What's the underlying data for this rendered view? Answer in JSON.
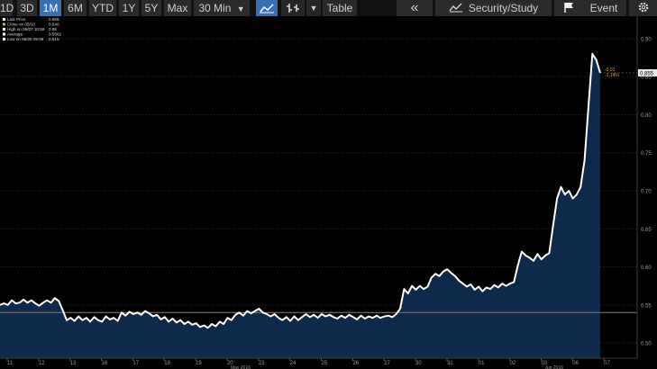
{
  "toolbar": {
    "ranges": [
      "1D",
      "3D",
      "1M",
      "6M",
      "YTD",
      "1Y",
      "5Y",
      "Max"
    ],
    "active_range": "1M",
    "interval": "30 Min",
    "interval_arrow": "▼",
    "chart_style_icon": "line-chart-icon",
    "bar_style_icon": "ohlc-bar-icon",
    "dropdown_arrow": "▼",
    "table_label": "Table",
    "collapse_icon": "double-chevron-left-icon",
    "collapse_glyph": "«",
    "security_label": "Security/Study",
    "security_icon": "study-icon",
    "event_label": "Event",
    "event_icon": "flag-icon",
    "settings_icon": "gear-icon"
  },
  "legend": {
    "lines": [
      {
        "label": "Last Price",
        "value": "0.855",
        "color": "#ffffff"
      },
      {
        "label": "Close on 05/10",
        "value": "0.540",
        "color": "#f0a030"
      },
      {
        "label": "High on 06/07 10:59",
        "value": "0.88",
        "color": "#ffffff"
      },
      {
        "label": "Average",
        "value": "0.5662",
        "color": "#ffffff"
      },
      {
        "label": "Low on 06/26 09:59",
        "value": "0.515",
        "color": "#ffffff"
      }
    ]
  },
  "colors": {
    "line": "#ffffff",
    "fill": "#0d2a4d",
    "ref_line": "#b07a2a",
    "grid": "#2a2a2a",
    "axis_text": "#9a9a9a"
  },
  "chart_data": {
    "type": "area",
    "yticks": [
      0.9,
      0.85,
      0.8,
      0.75,
      0.7,
      0.65,
      0.6,
      0.55,
      0.5
    ],
    "ylim": [
      0.48,
      0.92
    ],
    "ref_value": 0.54,
    "last_label": "0.855",
    "change_label": "-0.01",
    "change_pct": "-1.14%",
    "x_ticks": [
      "11",
      "12",
      "13",
      "16",
      "17",
      "18",
      "19",
      "20",
      "23",
      "24",
      "25",
      "26",
      "27",
      "30",
      "31",
      "01",
      "02",
      "03",
      "06",
      "07"
    ],
    "month_labels": [
      {
        "text": "May 2016",
        "after_tick": "20"
      },
      {
        "text": "Jun 2016",
        "after_tick": "03"
      }
    ],
    "values": [
      0.55,
      0.552,
      0.55,
      0.556,
      0.552,
      0.553,
      0.557,
      0.553,
      0.556,
      0.552,
      0.549,
      0.553,
      0.556,
      0.553,
      0.559,
      0.555,
      0.543,
      0.53,
      0.533,
      0.529,
      0.535,
      0.53,
      0.533,
      0.528,
      0.534,
      0.53,
      0.528,
      0.535,
      0.531,
      0.533,
      0.529,
      0.54,
      0.536,
      0.541,
      0.538,
      0.54,
      0.537,
      0.542,
      0.539,
      0.535,
      0.537,
      0.531,
      0.534,
      0.528,
      0.532,
      0.527,
      0.53,
      0.525,
      0.528,
      0.524,
      0.526,
      0.521,
      0.523,
      0.52,
      0.525,
      0.522,
      0.528,
      0.525,
      0.533,
      0.53,
      0.537,
      0.54,
      0.536,
      0.542,
      0.539,
      0.542,
      0.545,
      0.54,
      0.538,
      0.535,
      0.538,
      0.533,
      0.53,
      0.534,
      0.529,
      0.535,
      0.53,
      0.534,
      0.538,
      0.534,
      0.537,
      0.533,
      0.538,
      0.535,
      0.537,
      0.534,
      0.532,
      0.536,
      0.533,
      0.537,
      0.534,
      0.531,
      0.536,
      0.532,
      0.535,
      0.533,
      0.536,
      0.533,
      0.535,
      0.536,
      0.534,
      0.538,
      0.545,
      0.571,
      0.565,
      0.575,
      0.57,
      0.575,
      0.571,
      0.574,
      0.586,
      0.591,
      0.588,
      0.594,
      0.597,
      0.592,
      0.588,
      0.582,
      0.578,
      0.574,
      0.577,
      0.57,
      0.574,
      0.568,
      0.573,
      0.571,
      0.576,
      0.573,
      0.578,
      0.575,
      0.578,
      0.58,
      0.602,
      0.62,
      0.615,
      0.612,
      0.608,
      0.617,
      0.61,
      0.615,
      0.618,
      0.655,
      0.69,
      0.705,
      0.695,
      0.7,
      0.69,
      0.695,
      0.705,
      0.74,
      0.81,
      0.88,
      0.872,
      0.855
    ]
  }
}
